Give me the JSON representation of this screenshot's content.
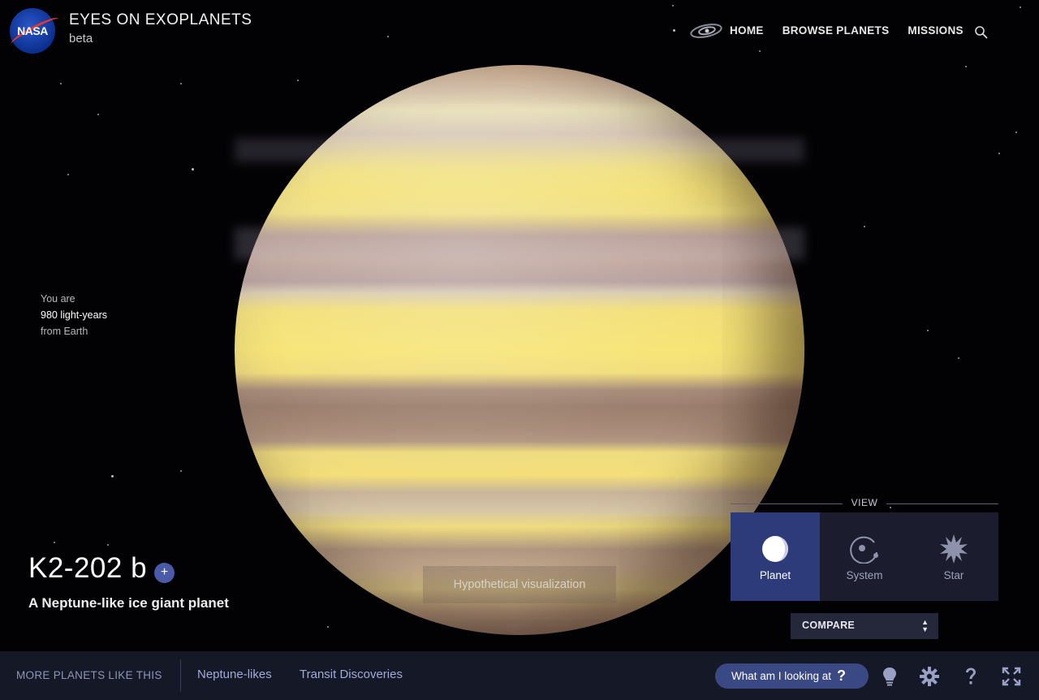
{
  "header": {
    "logo": "NASA",
    "title": "EYES ON EXOPLANETS",
    "subtitle": "beta",
    "nav": [
      "HOME",
      "BROWSE PLANETS",
      "MISSIONS"
    ],
    "icons": [
      "galaxy-icon",
      "search-icon"
    ]
  },
  "distance": {
    "line1": "You are",
    "line2": "980 light-years",
    "line3": "from Earth"
  },
  "planet": {
    "name": "K2-202 b",
    "add_label": "+",
    "description": "A Neptune-like ice giant planet",
    "visualization_note": "Hypothetical visualization"
  },
  "view": {
    "label": "VIEW",
    "options": [
      "Planet",
      "System",
      "Star"
    ],
    "active": "Planet"
  },
  "compare": {
    "label": "COMPARE"
  },
  "bottom_bar": {
    "more_label": "MORE PLANETS LIKE THIS",
    "tags": [
      "Neptune-likes",
      "Transit Discoveries"
    ],
    "what_label": "What am I looking at",
    "what_icon": "?",
    "tools": [
      "lightbulb-icon",
      "settings-icon",
      "help-icon",
      "fullscreen-icon"
    ]
  },
  "colors": {
    "accent": "#2d3b7a",
    "panel": "#1b1d2f",
    "bottom_bar": "#151826",
    "tag_text": "#a3a9d6"
  }
}
